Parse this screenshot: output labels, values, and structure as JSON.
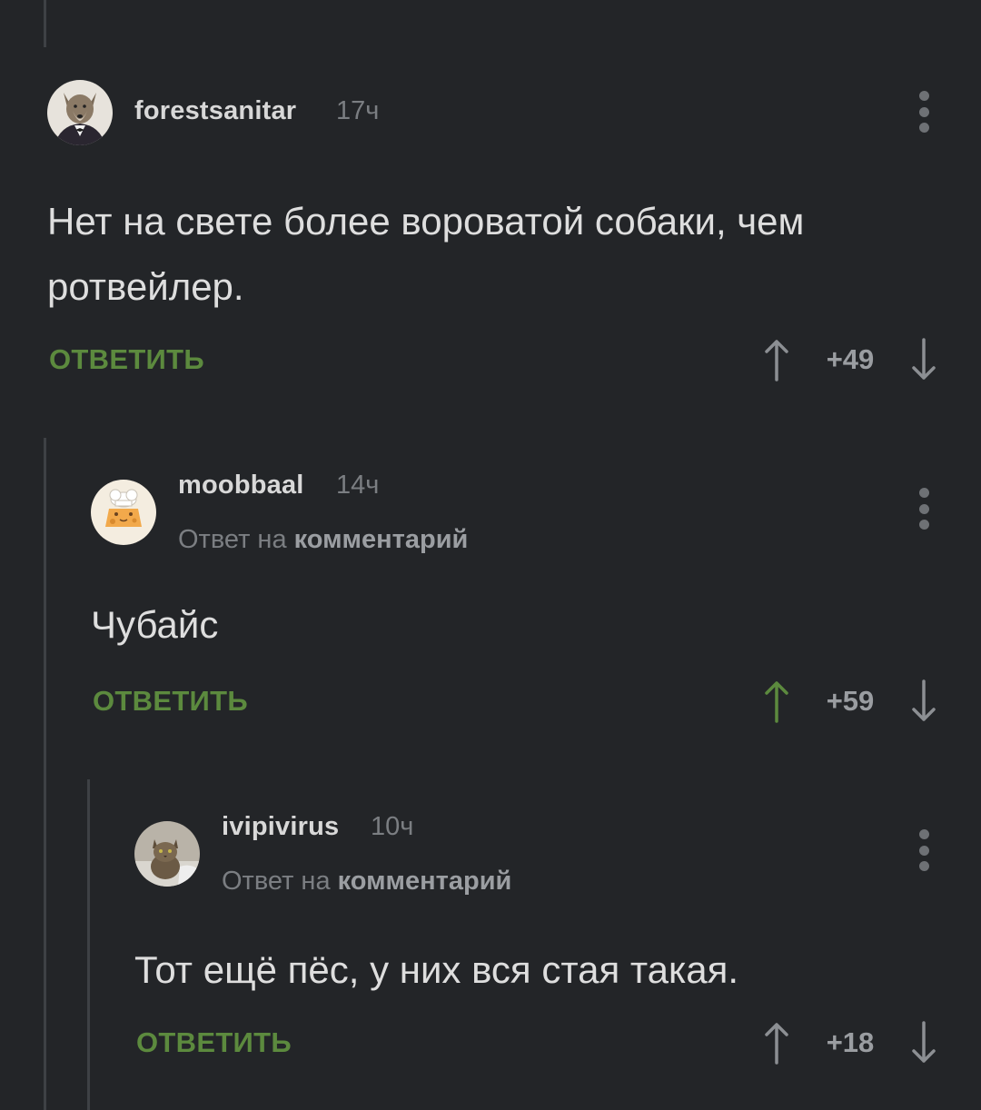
{
  "comments": [
    {
      "username": "forestsanitar",
      "time": "17ч",
      "text": "Нет на свете более вороватой собаки, чем ротвейлер.",
      "reply_label": "ОТВЕТИТЬ",
      "rating": "+49",
      "upvoted": false,
      "avatar_icon": "wolf-in-suit-avatar"
    },
    {
      "username": "moobbaal",
      "time": "14ч",
      "reply_prefix": "Ответ на",
      "reply_link": "комментарий",
      "text": "Чубайс",
      "reply_label": "ОТВЕТИТЬ",
      "rating": "+59",
      "upvoted": true,
      "avatar_icon": "cheese-chef-avatar"
    },
    {
      "username": "ivipivirus",
      "time": "10ч",
      "reply_prefix": "Ответ на",
      "reply_link": "комментарий",
      "text": "Тот ещё пёс, у них вся стая такая.",
      "reply_label": "ОТВЕТИТЬ",
      "rating": "+18",
      "upvoted": false,
      "avatar_icon": "cat-avatar"
    }
  ],
  "colors": {
    "background": "#232528",
    "reply_green": "#5c8a3e",
    "upvote_active": "#5c8a3e",
    "muted": "#7b7e82",
    "thread_line": "#3e4145"
  }
}
